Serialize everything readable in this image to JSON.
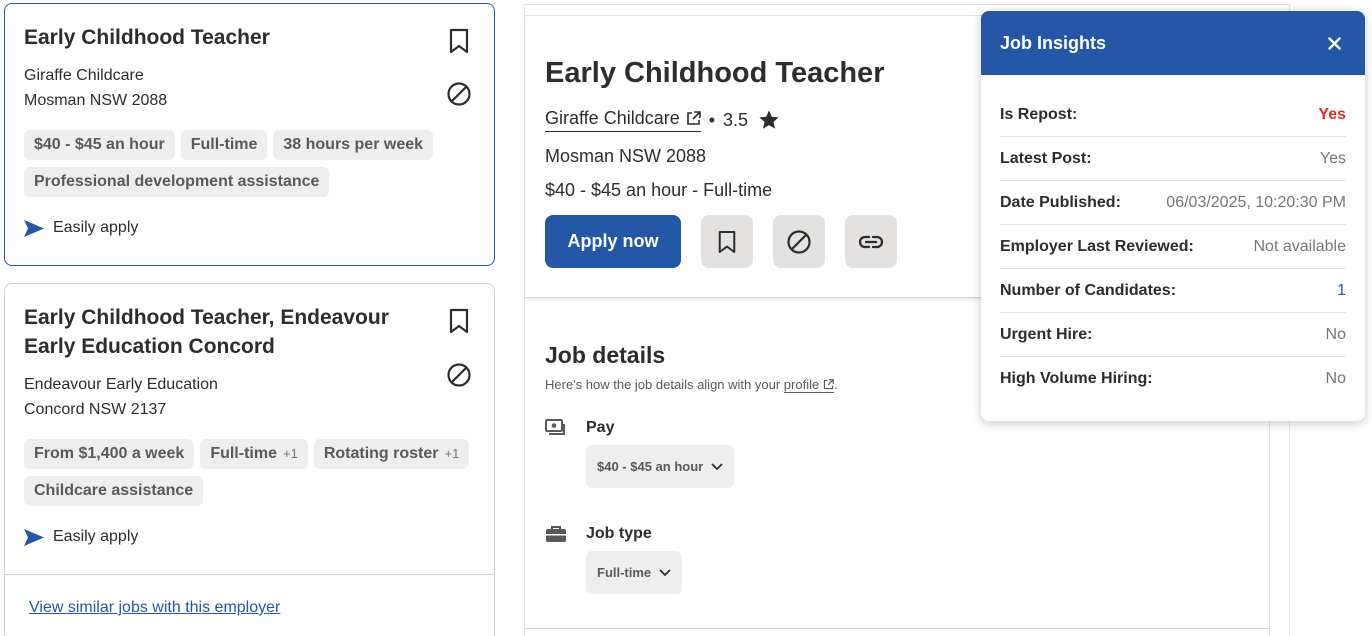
{
  "job_cards": [
    {
      "title": "Early Childhood Teacher",
      "company": "Giraffe Childcare",
      "location": "Mosman NSW 2088",
      "tags": [
        {
          "text": "$40 - $45 an hour",
          "extra": ""
        },
        {
          "text": "Full-time",
          "extra": ""
        },
        {
          "text": "38 hours per week",
          "extra": ""
        },
        {
          "text": "Professional development assistance",
          "extra": ""
        }
      ],
      "easily_apply": "Easily apply"
    },
    {
      "title": "Early Childhood Teacher, Endeavour Early Education Concord",
      "company": "Endeavour Early Education",
      "location": "Concord NSW 2137",
      "tags": [
        {
          "text": "From $1,400 a week",
          "extra": ""
        },
        {
          "text": "Full-time",
          "extra": "+1"
        },
        {
          "text": "Rotating roster",
          "extra": "+1"
        },
        {
          "text": "Childcare assistance",
          "extra": ""
        }
      ],
      "easily_apply": "Easily apply",
      "similar_link": "View similar jobs with this employer"
    }
  ],
  "detail": {
    "title": "Early Childhood Teacher",
    "company": "Giraffe Childcare",
    "separator": "•",
    "rating": "3.5",
    "location": "Mosman NSW 2088",
    "pay_summary": "$40 - $45 an hour  - Full-time",
    "apply_label": "Apply now",
    "job_details": {
      "heading": "Job details",
      "subtitle_prefix": "Here's how the job details align with your",
      "profile_link": "profile",
      "subtitle_suffix": ".",
      "pay_label": "Pay",
      "pay_value": "$40 - $45 an hour",
      "job_type_label": "Job type",
      "job_type_value": "Full-time"
    }
  },
  "insights": {
    "title": "Job Insights",
    "rows": [
      {
        "label": "Is Repost:",
        "value": "Yes"
      },
      {
        "label": "Latest Post:",
        "value": "Yes"
      },
      {
        "label": "Date Published:",
        "value": "06/03/2025, 10:20:30 PM"
      },
      {
        "label": "Employer Last Reviewed:",
        "value": "Not available"
      },
      {
        "label": "Number of Candidates:",
        "value": "1"
      },
      {
        "label": "Urgent Hire:",
        "value": "No"
      },
      {
        "label": "High Volume Hiring:",
        "value": "No"
      }
    ]
  },
  "colors": {
    "accent": "#2557a7",
    "repost_yes": "#d93025",
    "tag_bg": "#eeeeee"
  },
  "icons": {
    "save": "bookmark-icon",
    "not_interested": "ban-icon",
    "easily_apply": "send-arrow-icon",
    "external": "external-link-icon",
    "rating": "star-icon",
    "copy_link": "link-icon",
    "pay": "money-icon",
    "job_type": "briefcase-icon",
    "dropdown": "chevron-down-icon",
    "close": "close-icon"
  }
}
